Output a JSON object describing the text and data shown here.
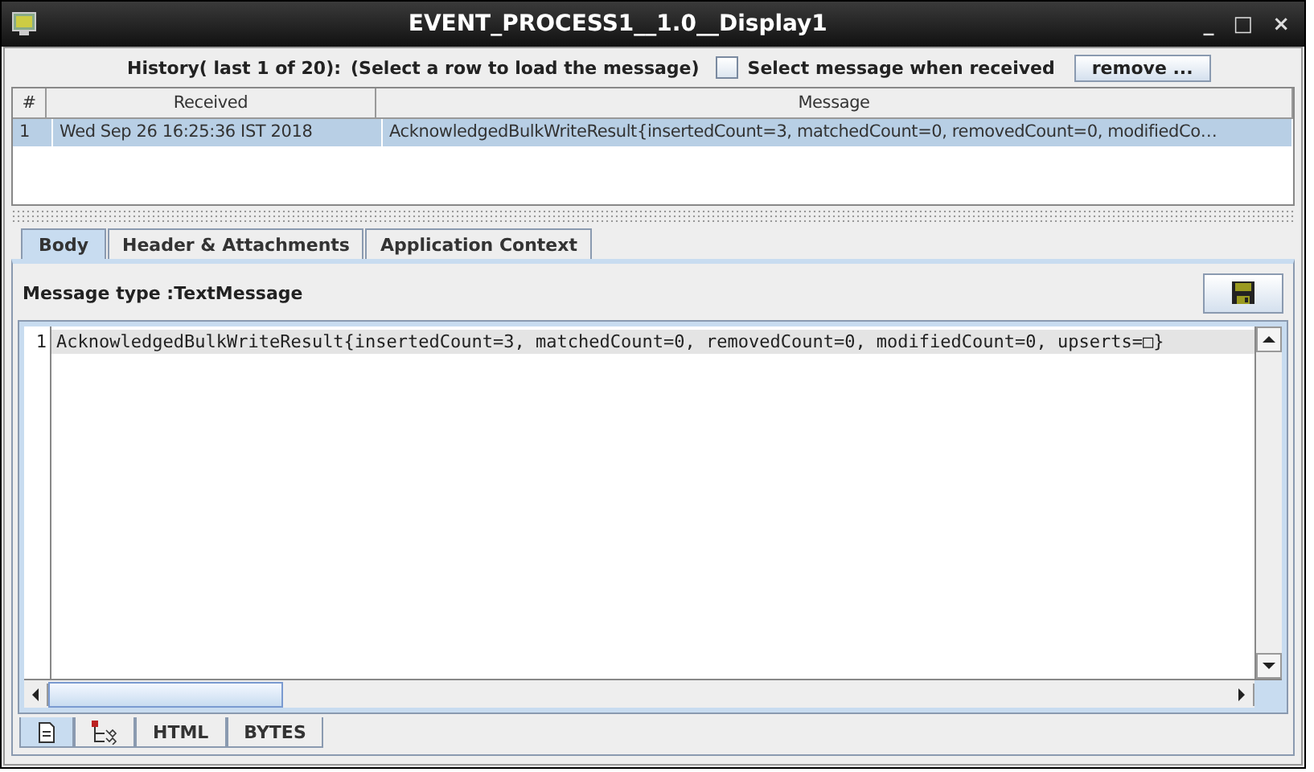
{
  "window": {
    "title": "EVENT_PROCESS1__1.0__Display1",
    "controls": [
      "_",
      "□",
      "×"
    ]
  },
  "history": {
    "label": "History( last 1 of 20):",
    "hint": "(Select a row to load the message)",
    "select_when_received": {
      "label": "Select message when received",
      "checked": false
    },
    "remove_button": "remove ..."
  },
  "table": {
    "columns": [
      "#",
      "Received",
      "Message"
    ],
    "rows": [
      {
        "cells": [
          "1",
          "Wed Sep 26 16:25:36 IST 2018",
          "AcknowledgedBulkWriteResult{insertedCount=3, matchedCount=0, removedCount=0, modifiedCo…"
        ],
        "selected": true
      }
    ]
  },
  "tabs": [
    {
      "label": "Body",
      "selected": true
    },
    {
      "label": "Header & Attachments",
      "selected": false
    },
    {
      "label": "Application Context",
      "selected": false
    }
  ],
  "message_type": "Message type :TextMessage",
  "editor": {
    "lines": [
      {
        "number": "1",
        "text": "AcknowledgedBulkWriteResult{insertedCount=3, matchedCount=0, removedCount=0, modifiedCount=0, upserts=□}"
      }
    ]
  },
  "view_tabs": [
    {
      "kind": "document",
      "selected": true
    },
    {
      "kind": "tree",
      "selected": false
    },
    {
      "kind": "text",
      "label": "HTML",
      "selected": false
    },
    {
      "kind": "text",
      "label": "BYTES",
      "selected": false
    }
  ]
}
